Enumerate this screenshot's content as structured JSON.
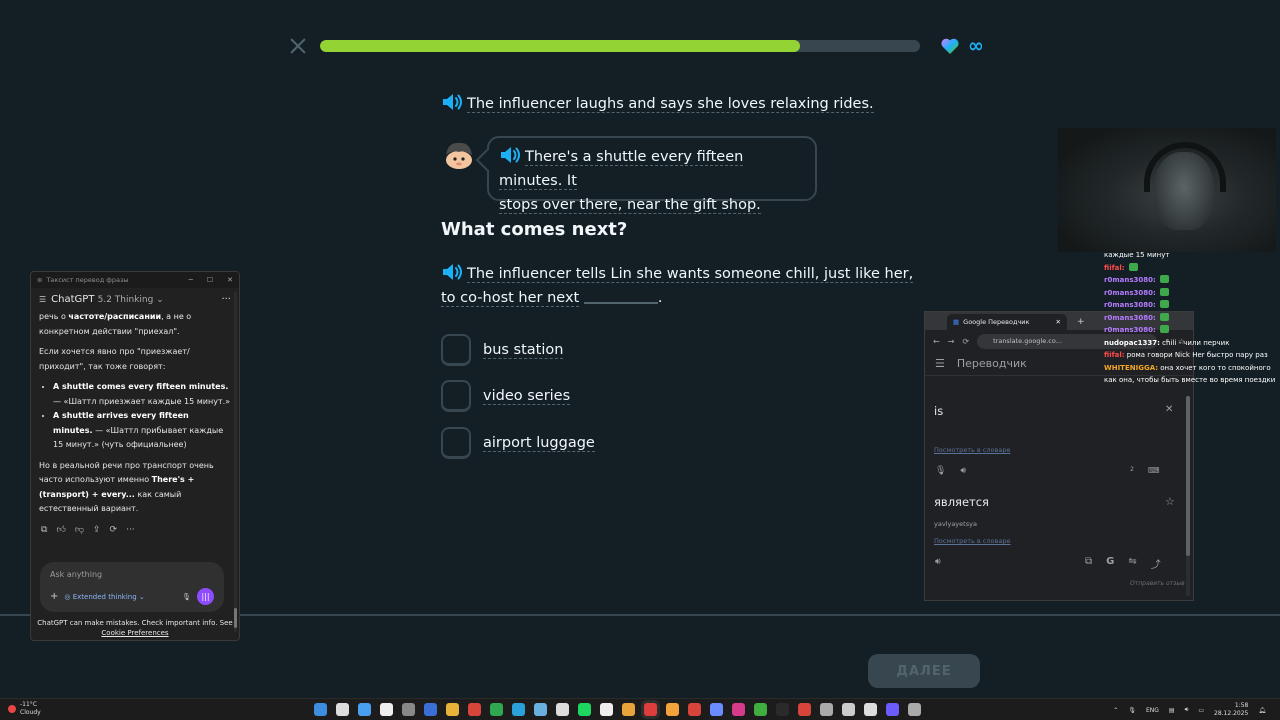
{
  "lesson": {
    "progress_percent": 80,
    "hearts": "∞",
    "line1": "The influencer laughs and says she loves relaxing rides.",
    "bubble_line1": "There's a shuttle every fifteen minutes. It",
    "bubble_line2": "stops over there, near the gift shop.",
    "question": "What comes next?",
    "prompt_line1": "The influencer tells Lin she wants someone chill, just like her,",
    "prompt_line2_before": "to co-host her next",
    "prompt_line2_after": ".",
    "options": [
      {
        "label": "bus station"
      },
      {
        "label": "video series"
      },
      {
        "label": "airport luggage"
      }
    ],
    "next_button": "ДАЛЕЕ",
    "colors": {
      "accent": "#93d333",
      "heart": "#1cb0f6",
      "track": "#37464f"
    }
  },
  "chatgpt": {
    "window_title": "Таксист перевод фразы",
    "model": "ChatGPT",
    "model_version": "5.2 Thinking",
    "p1_a": "речь о ",
    "p1_b": "частоте/расписании",
    "p1_c": ", а не о конкретном действии \"приехал\".",
    "p2": "Если хочется явно про \"приезжает/приходит\", так тоже говорят:",
    "b1_en": "A shuttle comes every fifteen minutes.",
    "b1_ru": " — «Шаттл приезжает каждые 15 минут.»",
    "b2_en": "A shuttle arrives every fifteen minutes.",
    "b2_ru": " — «Шаттл прибывает каждые 15 минут.» (чуть официальнее)",
    "p3_a": "Но в реальной речи про транспорт очень часто используют именно ",
    "p3_b": "There's + (transport) + every...",
    "p3_c": " как самый естественный вариант.",
    "input_placeholder": "Ask anything",
    "thinking_mode": "Extended thinking",
    "disclaimer": "ChatGPT can make mistakes. Check important info. See",
    "disclaimer_link": "Cookie Preferences",
    "brand_color": "#8f4bff"
  },
  "translate": {
    "tab_title": "Google Переводчик",
    "url": "translate.google.co...",
    "app_title": "Переводчик",
    "source_text": "is",
    "dict_link": "Посмотреть в словаре",
    "char_count": "2",
    "translation": "является",
    "transliteration": "yavlyayetsya",
    "dict_link2": "Посмотреть в словаре",
    "feedback": "Отправить отзыв"
  },
  "stream_chat": [
    {
      "user": "",
      "text": "каждые 15 минут",
      "color": "#ffffff"
    },
    {
      "user": "fiifal:",
      "text": "",
      "color": "#ff4b4b",
      "emote": true
    },
    {
      "user": "r0mans3080:",
      "text": "",
      "color": "#b57bff",
      "emote": true
    },
    {
      "user": "r0mans3080:",
      "text": "",
      "color": "#b57bff",
      "emote": true
    },
    {
      "user": "r0mans3080:",
      "text": "",
      "color": "#b57bff",
      "emote": true
    },
    {
      "user": "r0mans3080:",
      "text": "",
      "color": "#b57bff",
      "emote": true
    },
    {
      "user": "r0mans3080:",
      "text": "",
      "color": "#b57bff",
      "emote": true
    },
    {
      "user": "nudopac1337:",
      "text": " chili - чили перчик",
      "color": "#ffffff"
    },
    {
      "user": "fiifal:",
      "text": " рома говори Nick Her быстро пару раз",
      "color": "#ff4b4b"
    },
    {
      "user": "WHITENIGGA:",
      "text": " она хочет кого то спокойного",
      "color": "#f5a623"
    },
    {
      "user": "",
      "text": "как она, чтобы быть вместе во время поездки",
      "color": "#ffffff"
    }
  ],
  "taskbar": {
    "temperature": "-11°C",
    "weather": "Cloudy",
    "language": "ENG",
    "time": "1:58",
    "date": "28.12.2025"
  }
}
